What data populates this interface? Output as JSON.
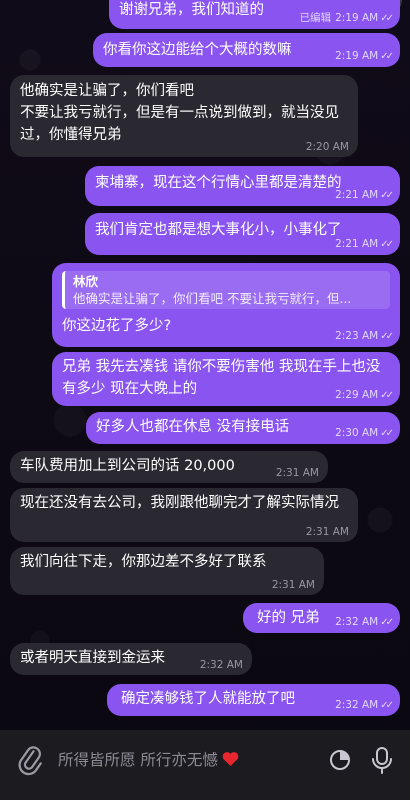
{
  "messages": [
    {
      "dir": "out",
      "text": "谢谢兄弟，我们知道的",
      "edited": "已编辑",
      "time": "2:19 AM",
      "ticks": "✓✓"
    },
    {
      "dir": "out",
      "text": "你看你这边能给个大概的数嘛",
      "time": "2:19 AM",
      "ticks": "✓✓"
    },
    {
      "dir": "in",
      "text": "他确实是让骗了，你们看吧\n不要让我亏就行，但是有一点说到做到，就当没见过，你懂得兄弟",
      "time": "2:20 AM"
    },
    {
      "dir": "out",
      "text": "柬埔寨，现在这个行情心里都是清楚的",
      "time": "2:21 AM",
      "ticks": "✓✓"
    },
    {
      "dir": "out",
      "text": "我们肯定也都是想大事化小，小事化了",
      "time": "2:21 AM",
      "ticks": "✓✓"
    },
    {
      "dir": "out",
      "reply": {
        "name": "林欣",
        "text": "他确实是让骗了，你们看吧 不要让我亏就行，但..."
      },
      "text": "你这边花了多少?",
      "time": "2:23 AM",
      "ticks": "✓✓"
    },
    {
      "dir": "out",
      "text": "兄弟 我先去凑钱 请你不要伤害他 我现在手上也没有多少 现在大晚上的",
      "time": "2:29 AM",
      "ticks": "✓✓"
    },
    {
      "dir": "out",
      "text": "好多人也都在休息 没有接电话",
      "time": "2:30 AM",
      "ticks": "✓✓"
    },
    {
      "dir": "in",
      "text": "车队费用加上到公司的话 20,000",
      "time": "2:31 AM"
    },
    {
      "dir": "in",
      "text": "现在还没有去公司，我刚跟他聊完才了解实际情况",
      "time": "2:31 AM"
    },
    {
      "dir": "in",
      "text": "我们向往下走，你那边差不多好了联系",
      "time": "2:31 AM"
    },
    {
      "dir": "out",
      "text": "好的 兄弟",
      "time": "2:32 AM",
      "ticks": "✓✓"
    },
    {
      "dir": "in",
      "text": "或者明天直接到金运来",
      "time": "2:32 AM"
    },
    {
      "dir": "out",
      "text": "确定凑够钱了人就能放了吧",
      "time": "2:32 AM",
      "ticks": "✓✓"
    }
  ],
  "composer": {
    "placeholder": "所得皆所愿 所行亦无憾",
    "attach_icon": "paperclip-icon",
    "sticker_icon": "sticker-icon",
    "mic_icon": "microphone-icon"
  },
  "colors": {
    "incoming_bubble": "#2a2830",
    "outgoing_bubble": "#8a54f0",
    "background": "#0d0a14"
  }
}
